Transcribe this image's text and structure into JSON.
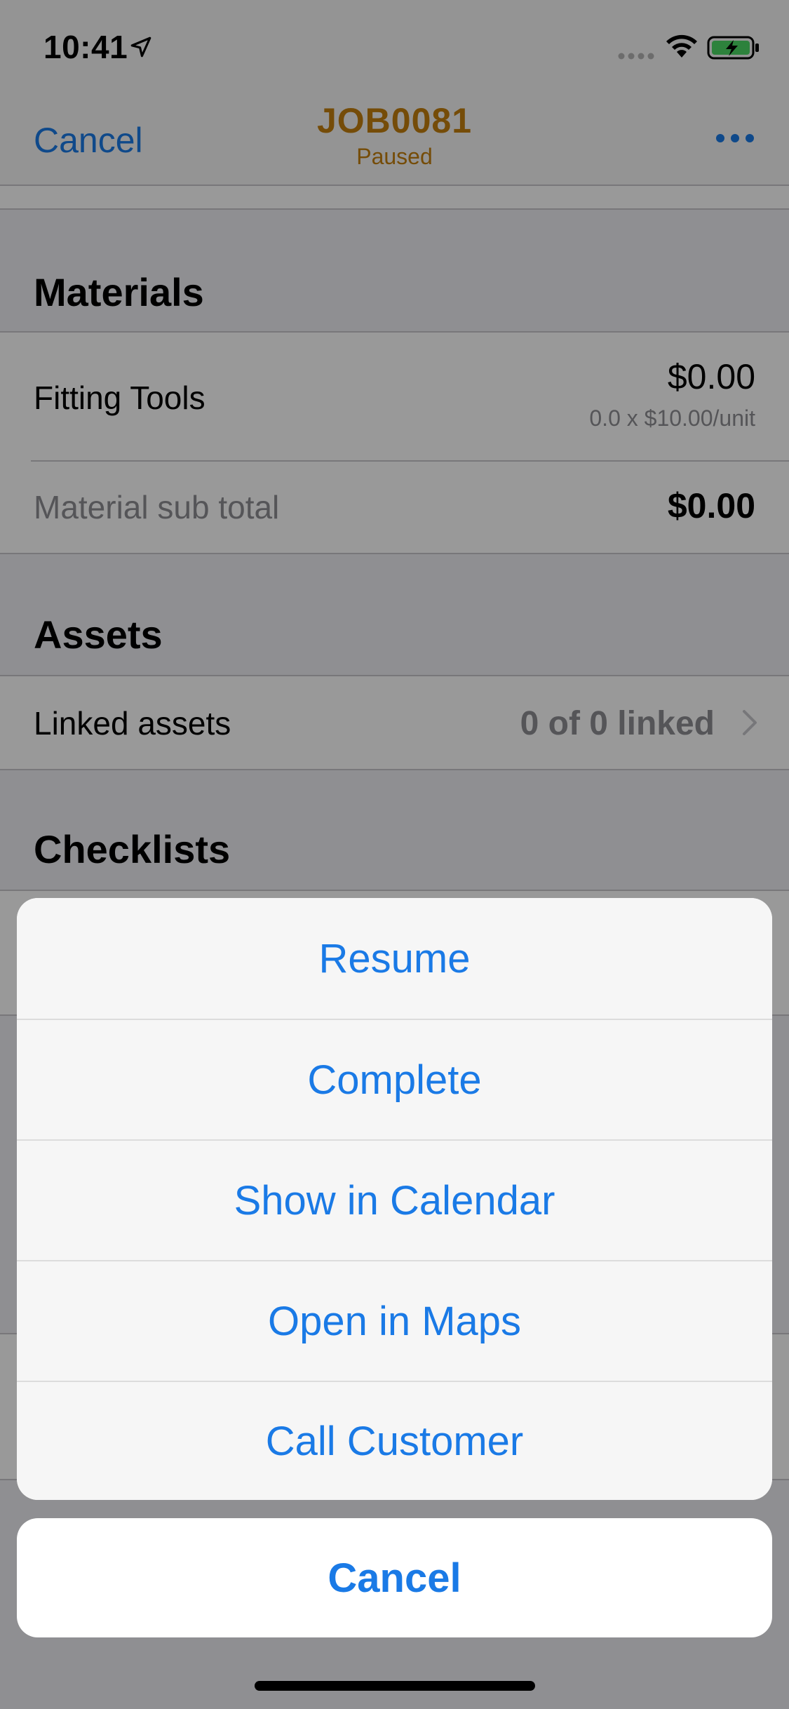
{
  "status_bar": {
    "time": "10:41",
    "icons": [
      "location-arrow-icon",
      "signal-dots-icon",
      "wifi-icon",
      "battery-charging-icon"
    ]
  },
  "nav": {
    "cancel_label": "Cancel",
    "title": "JOB0081",
    "subtitle": "Paused",
    "more_icon": "more-dots-icon",
    "title_color": "#c47f0e",
    "accent_color": "#1a7ae6"
  },
  "materials": {
    "header": "Materials",
    "items": [
      {
        "name": "Fitting Tools",
        "price": "$0.00",
        "detail": "0.0 x $10.00/unit"
      }
    ],
    "subtotal_label": "Material sub total",
    "subtotal_value": "$0.00"
  },
  "assets": {
    "header": "Assets",
    "linked_label": "Linked assets",
    "linked_value": "0 of 0 linked"
  },
  "checklists": {
    "header": "Checklists"
  },
  "action_sheet": {
    "actions": [
      {
        "label": "Resume"
      },
      {
        "label": "Complete"
      },
      {
        "label": "Show in Calendar"
      },
      {
        "label": "Open in Maps"
      },
      {
        "label": "Call Customer"
      }
    ],
    "cancel_label": "Cancel"
  }
}
